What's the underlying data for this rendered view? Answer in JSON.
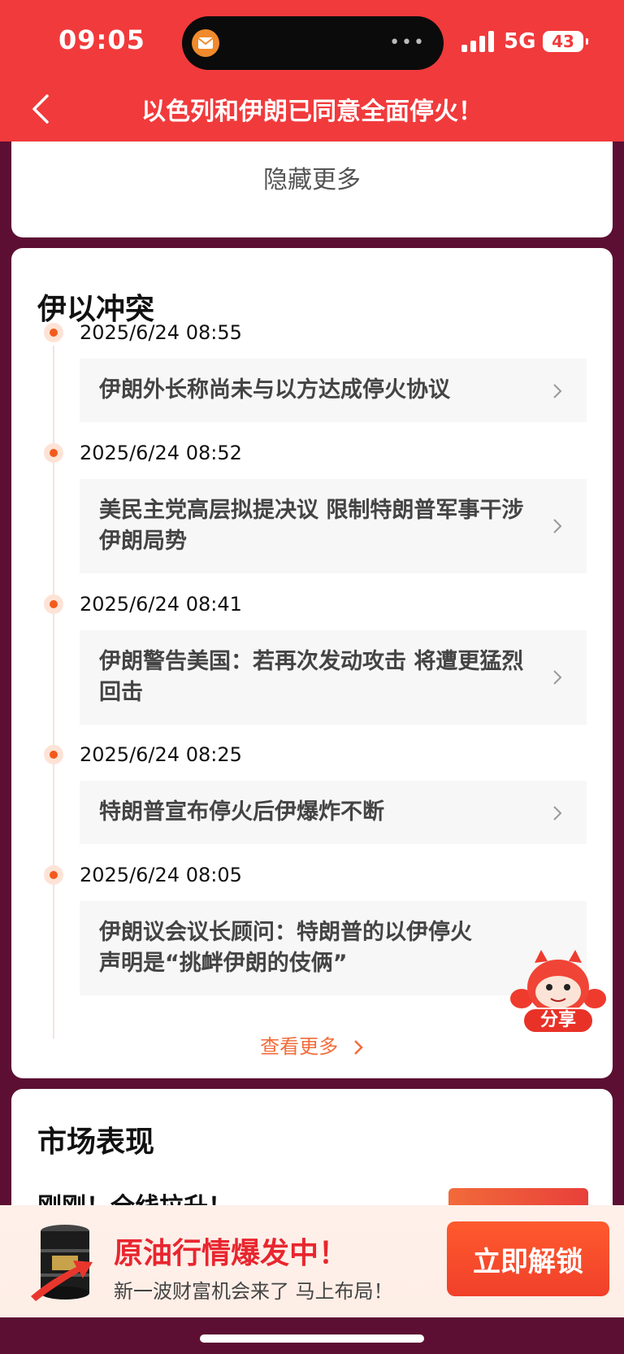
{
  "status_bar": {
    "time": "09:05",
    "network": "5G",
    "battery": "43"
  },
  "header": {
    "title": "以色列和伊朗已同意全面停火！"
  },
  "hide_more_label": "隐藏更多",
  "timeline": {
    "title": "伊以冲突",
    "items": [
      {
        "time": "2025/6/24 08:55",
        "text": "伊朗外长称尚未与以方达成停火协议"
      },
      {
        "time": "2025/6/24 08:52",
        "text": "美民主党高层拟提决议 限制特朗普军事干涉伊朗局势"
      },
      {
        "time": "2025/6/24 08:41",
        "text": "伊朗警告美国：若再次发动攻击 将遭更猛烈回击"
      },
      {
        "time": "2025/6/24 08:25",
        "text": "特朗普宣布停火后伊爆炸不断"
      },
      {
        "time": "2025/6/24 08:05",
        "text": "伊朗议会议长顾问：特朗普的以伊停火声明是“挑衅伊朗的伎俩”"
      }
    ],
    "see_more_label": "查看更多"
  },
  "share_label": "分享",
  "market": {
    "title": "市场表现",
    "snippet": "刚刚！全线拉升！"
  },
  "ad": {
    "title": "原油行情爆发中！",
    "subtitle": "新一波财富机会来了 马上布局！",
    "button_label": "立即解锁"
  },
  "colors": {
    "header_red": "#f13a3c",
    "background": "#5c0f33",
    "accent_orange": "#f26c3a"
  }
}
